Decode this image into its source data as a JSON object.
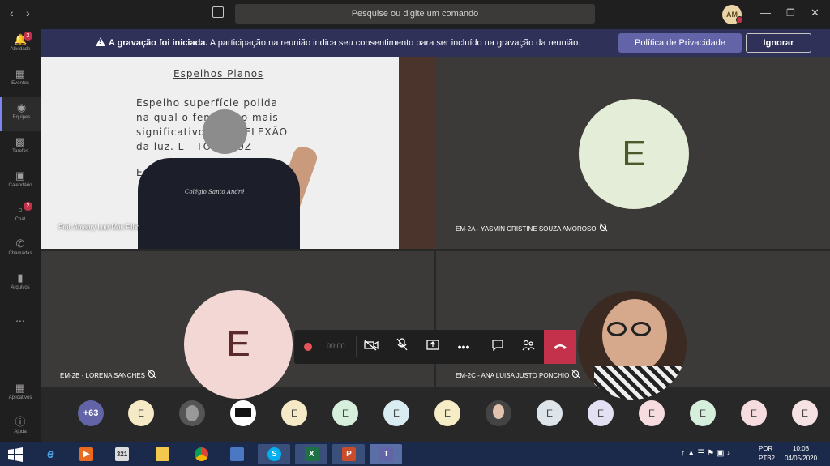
{
  "titlebar": {
    "back_icon": "chevron-left-icon",
    "forward_icon": "chevron-right-icon",
    "compose_icon": "compose-icon",
    "search_placeholder": "Pesquise ou digite um comando",
    "user_initials": "AM",
    "window_controls": [
      "minimize-icon",
      "restore-icon",
      "close-icon"
    ]
  },
  "rail": {
    "items": [
      {
        "label": "Atividade",
        "icon": "bell-icon",
        "badge": "2"
      },
      {
        "label": "Eventos",
        "icon": "calendar-event-icon",
        "badge": ""
      },
      {
        "label": "Equipes",
        "icon": "teams-icon",
        "badge": ""
      },
      {
        "label": "Tarefas",
        "icon": "assignments-icon",
        "badge": ""
      },
      {
        "label": "Calendário",
        "icon": "calendar-icon",
        "badge": ""
      },
      {
        "label": "Chat",
        "icon": "chat-icon",
        "badge": "2"
      },
      {
        "label": "Chamadas",
        "icon": "phone-icon",
        "badge": ""
      },
      {
        "label": "Arquivos",
        "icon": "files-icon",
        "badge": ""
      }
    ],
    "more": "...",
    "bottom": [
      {
        "label": "Aplicativos",
        "icon": "apps-icon"
      },
      {
        "label": "Ajuda",
        "icon": "help-icon"
      }
    ]
  },
  "banner": {
    "title": "A gravação foi iniciada.",
    "message": " A participação na reunião indica seu consentimento para ser incluído na gravação da reunião.",
    "privacy_button": "Política de Privacidade",
    "ignore_button": "Ignorar"
  },
  "tiles": {
    "teacher": {
      "name": "Prof. Amaury Luiz Mori Filho",
      "shirt_text": "Colégio Santo André"
    },
    "whiteboard_lines": [
      "Espelhos Planos",
      "Espelho superfície polida",
      "na qual o fenômeno mais",
      "significativo é a REFLEXÃO",
      "da luz.        L - TODA LUZ",
      "Esp"
    ],
    "top_right": {
      "name": "EM-2A - YASMIN CRISTINE SOUZA AMOROSO",
      "initial": "E"
    },
    "bottom_left": {
      "name": "EM-2B - LORENA SANCHES",
      "initial": "E"
    },
    "bottom_right": {
      "name": "EM-2C - ANA LUISA JUSTO PONCHIO"
    }
  },
  "controls": {
    "record_timer": "00:00",
    "items": [
      "camera-off-icon",
      "mic-off-icon",
      "share-screen-icon",
      "more-icon",
      "chat-icon",
      "participants-icon",
      "hang-up-icon"
    ]
  },
  "roster": {
    "overflow": "+63",
    "initials": [
      "E",
      "E",
      "E",
      "E",
      "E",
      "E",
      "E",
      "E",
      "E",
      "E",
      "E",
      "E"
    ]
  },
  "taskbar": {
    "language": "POR",
    "keyboard": "PTB2",
    "time": "10:08",
    "date": "04/05/2020"
  },
  "colors": {
    "accent": "#6264a7",
    "banner": "#2f3158",
    "hangup": "#c4314b",
    "avatar_green": "#e3edd8",
    "avatar_pink": "#f3d7d5"
  }
}
